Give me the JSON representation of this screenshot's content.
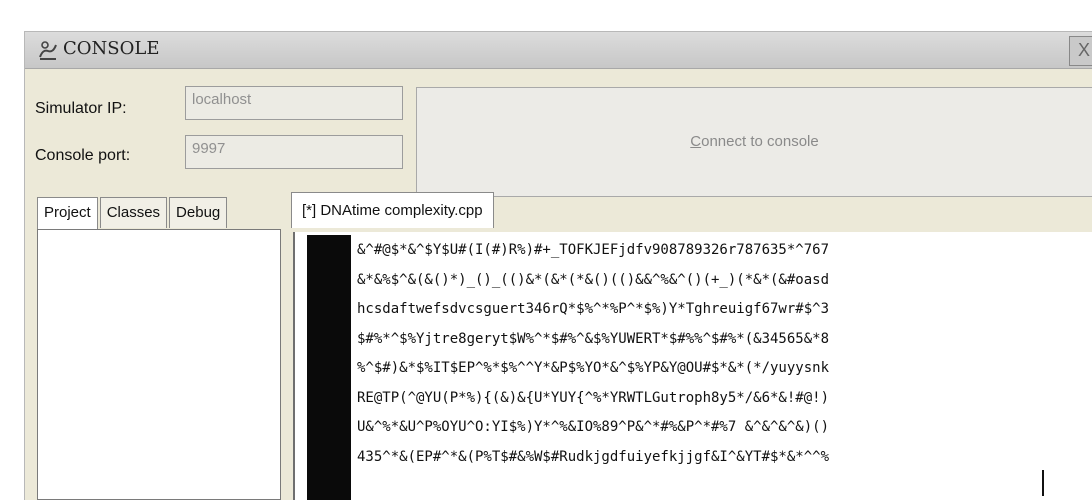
{
  "window": {
    "title": "CONSOLE",
    "close_label": "X",
    "icons": {
      "title": "console-icon",
      "close": "close-icon"
    }
  },
  "connection": {
    "simulator_ip_label": "Simulator IP:",
    "simulator_ip_value": "localhost",
    "console_port_label": "Console port:",
    "console_port_value": "9997",
    "connect_prefix": "",
    "connect_mnemonic": "C",
    "connect_rest": "onnect to console"
  },
  "left_tabs": [
    {
      "label": "Project",
      "active": true
    },
    {
      "label": "Classes",
      "active": false
    },
    {
      "label": "Debug",
      "active": false
    }
  ],
  "editor": {
    "tab_label": "[*] DNAtime complexity.cpp",
    "lines": [
      "&^#@$*&^$Y$U#(I(#)R%)#+_TOFKJEFjdfv908789326r787635*^767",
      "&*&%$^&(&()*)_()_(()&*(&*(*&()(()&&^%&^()(+_)(*&*(&#oasd",
      "hcsdaftwefsdvcsguert346rQ*$%^*%P^*$%)Y*Tghreuigf67wr#$^3",
      "$#%*^$%Yjtre8geryt$W%^*$#%^&$%YUWERT*$#%%^$#%*(&34565&*8",
      "%^$#)&*$%IT$EP^%*$%^^Y*&P$%YO*&^$%YP&Y@OU#$*&*(*/yuyysnk",
      "RE@TP(^@YU(P*%){(&)&{U*YUY{^%*YRWTLGutroph8y5*/&6*&!#@!)",
      "U&^%*&U^P%OYU^O:YI$%)Y*^%&IO%89^P&^*#%&P^*#%7 &^&^&^&)()",
      "435^*&(EP#^*&(P%T$#&%W$#Rudkjgdfuiyefkjjgf&I^&YT#$*&*^^%"
    ]
  }
}
